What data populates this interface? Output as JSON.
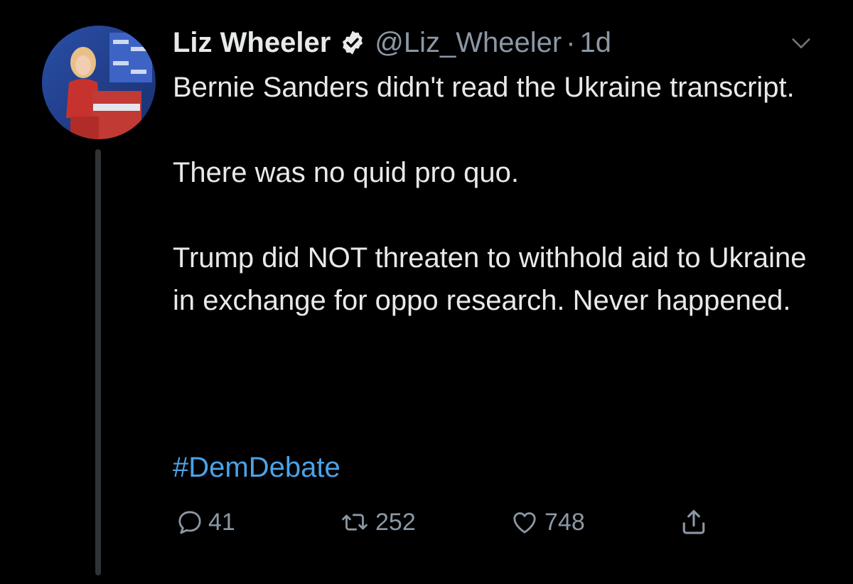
{
  "author": {
    "name": "Liz Wheeler",
    "handle": "@Liz_Wheeler",
    "separator": "·",
    "time": "1d"
  },
  "tweet": {
    "lines": [
      "Bernie Sanders didn't read the Ukraine transcript.",
      "There was no quid pro quo.",
      "Trump did NOT threaten to withhold aid to Ukraine in exchange for oppo research. Never happened."
    ],
    "hashtag": "#DemDebate"
  },
  "actions": {
    "replies": "41",
    "retweets": "252",
    "likes": "748"
  },
  "colors": {
    "background": "#000000",
    "text": "#e7e9ea",
    "muted": "#8b98a5",
    "link": "#4ba3e8",
    "thread_line": "#2f3336"
  },
  "icons": {
    "verified": "verified-badge-icon",
    "menu": "chevron-down-icon",
    "reply": "reply-icon",
    "retweet": "retweet-icon",
    "like": "heart-icon",
    "share": "share-icon"
  }
}
